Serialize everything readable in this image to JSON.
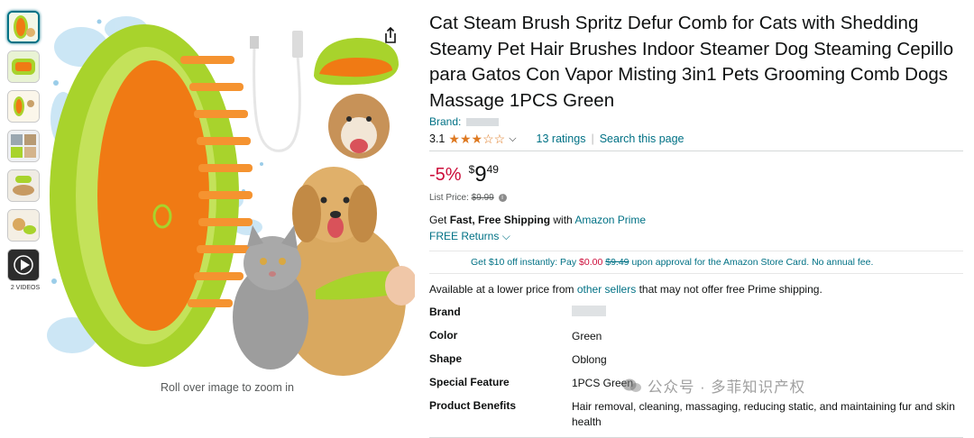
{
  "thumbnails": {
    "items": [
      "thumb-1",
      "thumb-2",
      "thumb-3",
      "thumb-4",
      "thumb-5",
      "thumb-6"
    ],
    "videos_label": "2 VIDEOS"
  },
  "image": {
    "zoom_hint": "Roll over image to zoom in"
  },
  "product": {
    "title": "Cat Steam Brush Spritz Defur Comb for Cats with Shedding Steamy Pet Hair Brushes Indoor Steamer Dog Steaming Cepillo para Gatos Con Vapor Misting 3in1 Pets Grooming Comb Dogs Massage 1PCS Green",
    "brand_label": "Brand:",
    "rating_value": "3.1",
    "rating_stars": 3.1,
    "ratings_count": "13 ratings",
    "search_link": "Search this page",
    "discount": "-5%",
    "currency": "$",
    "price_whole": "9",
    "price_fraction": "49",
    "list_price_label": "List Price:",
    "list_price": "$9.99",
    "ship_prefix": "Get ",
    "ship_bold": "Fast, Free Shipping",
    "ship_with": " with ",
    "ship_link": "Amazon Prime",
    "returns": "FREE Returns",
    "promo_a": "Get $10 off instantly: Pay ",
    "promo_price": "$0.00",
    "promo_strike": "$9.49",
    "promo_b": " upon approval for the Amazon Store Card. No annual fee.",
    "lower_a": "Available at a lower price from ",
    "lower_link": "other sellers",
    "lower_b": " that may not offer free Prime shipping."
  },
  "attributes": [
    {
      "key": "Brand",
      "value": ""
    },
    {
      "key": "Color",
      "value": "Green"
    },
    {
      "key": "Shape",
      "value": "Oblong"
    },
    {
      "key": "Special Feature",
      "value": "1PCS Green"
    },
    {
      "key": "Product Benefits",
      "value": "Hair removal, cleaning, massaging, reducing static, and maintaining fur and skin health"
    }
  ],
  "watermark": {
    "text": "公众号 · 多菲知识产权"
  },
  "colors": {
    "link": "#007185",
    "discount": "#cc0c39",
    "star": "#de7921",
    "brush_green": "#a8d32c",
    "brush_orange": "#f07a14"
  }
}
